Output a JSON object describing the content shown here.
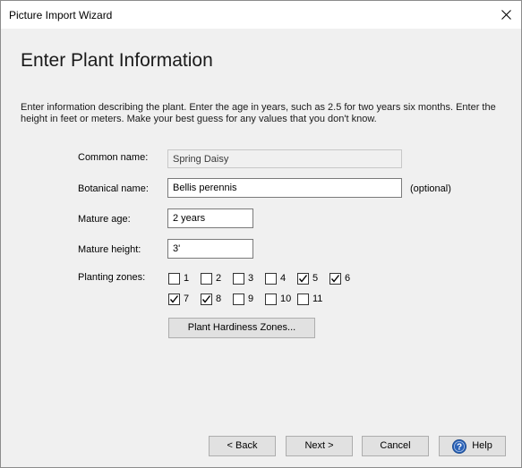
{
  "window": {
    "title": "Picture Import Wizard"
  },
  "page": {
    "title": "Enter Plant Information",
    "description": "Enter information describing the plant. Enter the age in years, such as 2.5 for two years six months. Enter the height in feet or meters. Make your best guess for any values that you don't know."
  },
  "form": {
    "common_name": {
      "label": "Common name:",
      "value": "Spring Daisy"
    },
    "botanical_name": {
      "label": "Botanical name:",
      "value": "Bellis perennis",
      "hint": "(optional)"
    },
    "mature_age": {
      "label": "Mature age:",
      "value": "2 years"
    },
    "mature_height": {
      "label": "Mature height:",
      "value": "3'"
    },
    "planting_zones": {
      "label": "Planting zones:",
      "zones": [
        {
          "label": "1",
          "checked": false
        },
        {
          "label": "2",
          "checked": false
        },
        {
          "label": "3",
          "checked": false
        },
        {
          "label": "4",
          "checked": false
        },
        {
          "label": "5",
          "checked": true
        },
        {
          "label": "6",
          "checked": true
        },
        {
          "label": "7",
          "checked": true
        },
        {
          "label": "8",
          "checked": true
        },
        {
          "label": "9",
          "checked": false
        },
        {
          "label": "10",
          "checked": false
        },
        {
          "label": "11",
          "checked": false
        }
      ]
    },
    "hardiness_button": "Plant Hardiness Zones..."
  },
  "footer": {
    "back": "< Back",
    "next": "Next >",
    "cancel": "Cancel",
    "help": "Help"
  },
  "icons": {
    "close": "close-icon",
    "help": "help-icon",
    "check": "checkmark-icon"
  },
  "colors": {
    "window_bg": "#f0f0f0",
    "button_bg": "#e1e1e1",
    "help_icon_bg": "#2a62b8"
  }
}
